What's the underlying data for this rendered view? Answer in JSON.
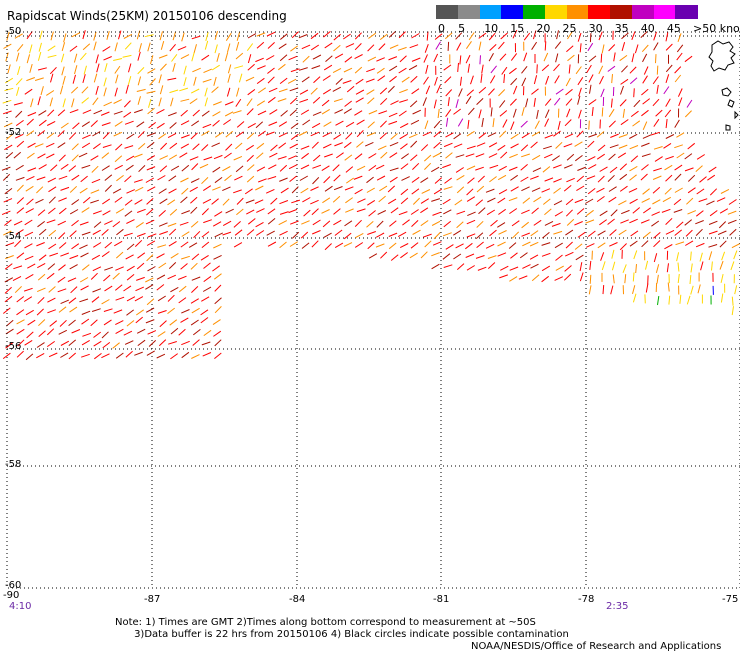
{
  "title": "Rapidscat Winds(25KM) 20150106 descending",
  "legend": {
    "labels": [
      "0",
      "5",
      "10",
      "15",
      "20",
      "25",
      "30",
      "35",
      "40",
      "45",
      ">50 knots"
    ],
    "colors": [
      "#555555",
      "#8a8a8a",
      "#00a0ff",
      "#0000ff",
      "#00b000",
      "#ffd800",
      "#ff9000",
      "#ff0000",
      "#b01000",
      "#c000c0",
      "#ff00ff",
      "#6a00b0"
    ]
  },
  "axes": {
    "lat_labels": [
      "-50",
      "-52",
      "-54",
      "-56",
      "-58",
      "-60"
    ],
    "lon_labels": [
      "-87",
      "-84",
      "-81",
      "-78",
      "-75"
    ],
    "corner_label": "-90"
  },
  "times": {
    "start": "4:10",
    "end": "2:35"
  },
  "notes": [
    "Note: 1) Times are GMT 2)Times along bottom correspond to measurement at ~50S",
    "      3)Data buffer is 22 hrs from 20150106 4) Black circles indicate possible contamination"
  ],
  "credit": "NOAA/NESDIS/Office of Research and Applications"
}
